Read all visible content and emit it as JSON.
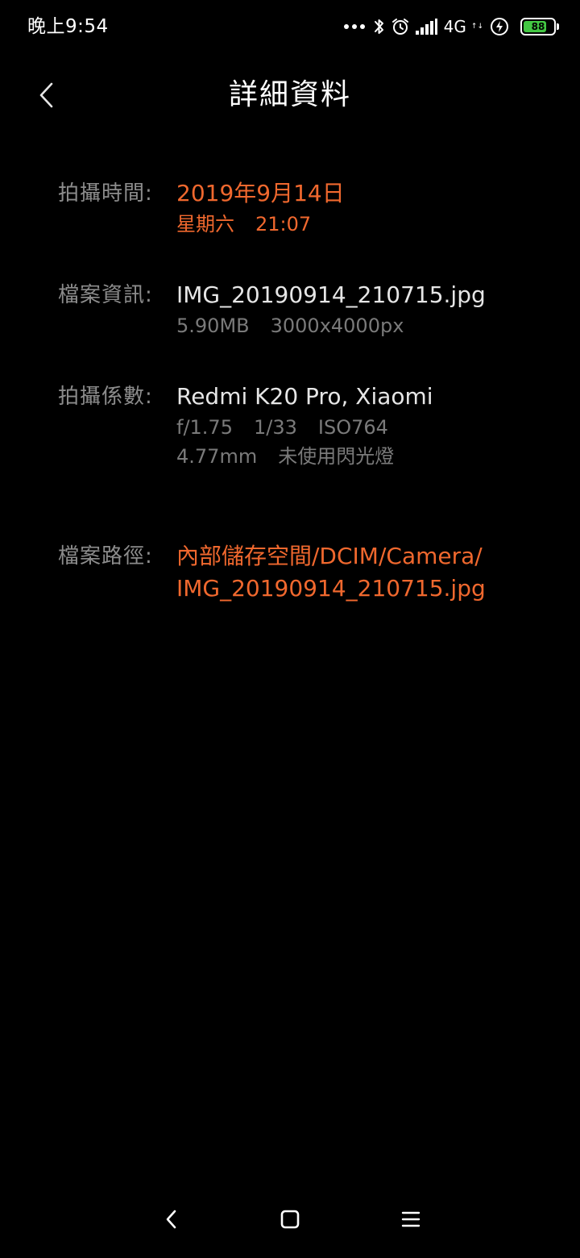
{
  "status_bar": {
    "time": "晚上9:54",
    "network": "4G",
    "network_arrows": "↑↓",
    "battery_level": "88",
    "battery_percent": 88,
    "battery_color": "#43c743",
    "icons": [
      "more-dots-icon",
      "bluetooth-icon",
      "alarm-icon",
      "signal-icon",
      "charging-icon",
      "battery-icon"
    ]
  },
  "header": {
    "title": "詳細資料",
    "back_icon": "chevron-left-icon"
  },
  "details": {
    "capture_time": {
      "label": "拍攝時間:",
      "date": "2019年9月14日",
      "weekday": "星期六",
      "time": "21:07"
    },
    "file_info": {
      "label": "檔案資訊:",
      "filename": "IMG_20190914_210715.jpg",
      "size": "5.90MB",
      "resolution": "3000x4000px"
    },
    "capture_params": {
      "label": "拍攝係數:",
      "device": "Redmi K20 Pro, Xiaomi",
      "aperture": "f/1.75",
      "shutter": "1/33",
      "iso": "ISO764",
      "focal_length": "4.77mm",
      "flash": "未使用閃光燈"
    },
    "file_path": {
      "label": "檔案路徑:",
      "line1": "內部儲存空間/DCIM/Camera/",
      "line2": "IMG_20190914_210715.jpg"
    }
  },
  "colors": {
    "background": "#000000",
    "accent": "#f0682e",
    "label": "#8c8c8c",
    "primary_text": "#e6e6e6",
    "secondary_text": "#7a7a7a"
  },
  "nav_bar": {
    "icons": [
      "nav-back-icon",
      "nav-home-icon",
      "nav-menu-icon"
    ]
  }
}
